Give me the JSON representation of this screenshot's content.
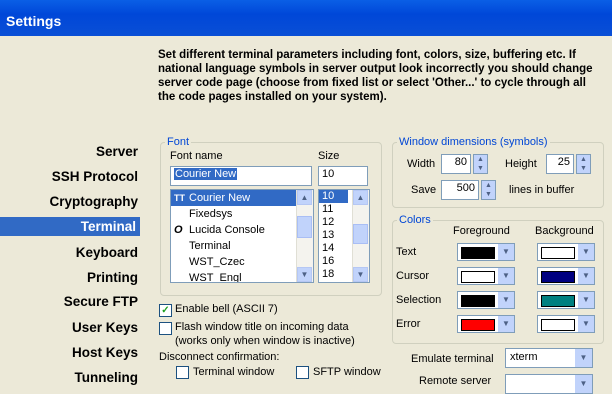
{
  "window": {
    "title": "Settings"
  },
  "description": "Set different terminal parameters including font, colors, size, buffering etc. If national language symbols in server output look incorrectly you should change server code page (choose from fixed list or select 'Other...' to cycle through all the code pages installed on your system).",
  "nav": {
    "items": [
      {
        "label": "Server"
      },
      {
        "label": "SSH Protocol"
      },
      {
        "label": "Cryptography"
      },
      {
        "label": "Terminal"
      },
      {
        "label": "Keyboard"
      },
      {
        "label": "Printing"
      },
      {
        "label": "Secure FTP"
      },
      {
        "label": "User Keys"
      },
      {
        "label": "Host Keys"
      },
      {
        "label": "Tunneling"
      }
    ],
    "selected": "Terminal"
  },
  "font": {
    "group_label": "Font",
    "name_label": "Font name",
    "size_label": "Size",
    "name_value": "Courier New",
    "size_value": "10",
    "fonts": [
      "Courier New",
      "Fixedsys",
      "Lucida Console",
      "Terminal",
      "WST_Czec",
      "WST_Engl"
    ],
    "font_icons": [
      "TT",
      "",
      "O",
      "",
      "",
      ""
    ],
    "sizes": [
      "10",
      "11",
      "12",
      "13",
      "14",
      "16",
      "18"
    ]
  },
  "window_dimensions": {
    "group_label": "Window dimensions (symbols)",
    "width_label": "Width",
    "width_value": "80",
    "height_label": "Height",
    "height_value": "25",
    "save_label": "Save",
    "save_value": "500",
    "buffer_suffix": "lines in buffer"
  },
  "colors": {
    "group_label": "Colors",
    "fg_header": "Foreground",
    "bg_header": "Background",
    "rows": [
      {
        "label": "Text",
        "fg": "#000000",
        "bg": "#ffffff"
      },
      {
        "label": "Cursor",
        "fg": "#ffffff",
        "bg": "#000080"
      },
      {
        "label": "Selection",
        "fg": "#000000",
        "bg": "#008080"
      },
      {
        "label": "Error",
        "fg": "#ff0000",
        "bg": "#ffffff"
      }
    ]
  },
  "options": {
    "enable_bell": "Enable bell (ASCII 7)",
    "enable_bell_checked": true,
    "flash_title": "Flash window title on incoming data",
    "flash_title_note": "(works only when window is inactive)",
    "flash_title_checked": false,
    "disconnect_label": "Disconnect confirmation:",
    "terminal_window": "Terminal window",
    "sftp_window": "SFTP window"
  },
  "emulate": {
    "label": "Emulate terminal",
    "value": "xterm"
  },
  "remote_server": {
    "label": "Remote server"
  },
  "colors_theme": {
    "selection": "#316ac5",
    "title_bar": "#0a5fe6",
    "group_label": "#0046d5"
  }
}
